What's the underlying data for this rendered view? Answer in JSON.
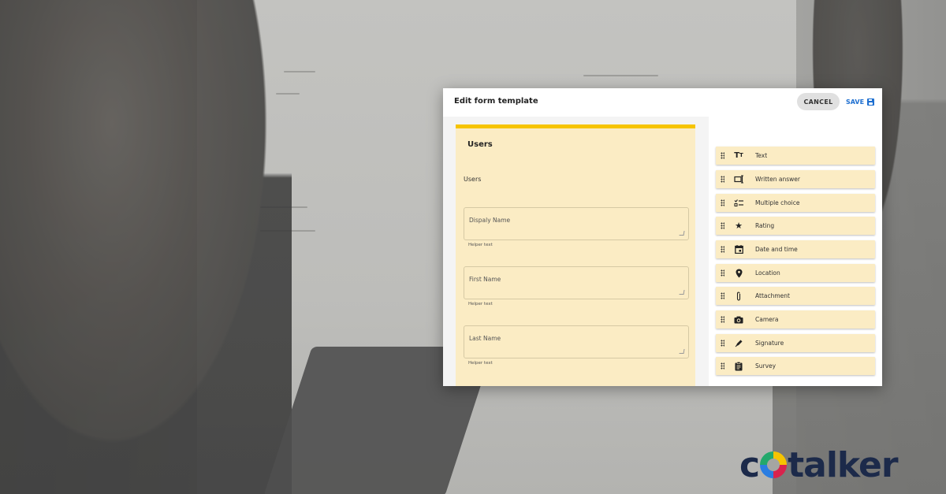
{
  "modal": {
    "title": "Edit form template",
    "cancel_label": "CANCEL",
    "save_label": "SAVE"
  },
  "form": {
    "card_title": "Users",
    "section_label": "Users",
    "fields": [
      {
        "label": "Dispaly Name",
        "helper": "Helper text"
      },
      {
        "label": "First Name",
        "helper": "Helper text"
      },
      {
        "label": "Last Name",
        "helper": "Helper text"
      }
    ]
  },
  "palette": {
    "items": [
      {
        "label": "Text",
        "icon": "text-icon"
      },
      {
        "label": "Written answer",
        "icon": "written-answer-icon"
      },
      {
        "label": "Multiple choice",
        "icon": "multiple-choice-icon"
      },
      {
        "label": "Rating",
        "icon": "star-icon"
      },
      {
        "label": "Date and time",
        "icon": "calendar-icon"
      },
      {
        "label": "Location",
        "icon": "location-pin-icon"
      },
      {
        "label": "Attachment",
        "icon": "paperclip-icon"
      },
      {
        "label": "Camera",
        "icon": "camera-icon"
      },
      {
        "label": "Signature",
        "icon": "pen-icon"
      },
      {
        "label": "Survey",
        "icon": "clipboard-icon"
      }
    ]
  },
  "brand": {
    "logo_prefix": "c",
    "logo_suffix": "talker",
    "accent_yellow": "#f6c400",
    "save_blue": "#1e6fd0"
  }
}
